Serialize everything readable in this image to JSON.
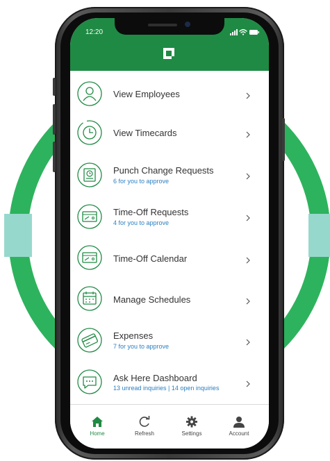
{
  "status_bar": {
    "time": "12:20"
  },
  "colors": {
    "brand_green": "#1f8a44",
    "ring_green": "#2db35d",
    "ring_teal": "#97d8cc",
    "link_blue": "#2a7fc1"
  },
  "menu": {
    "items": [
      {
        "title": "View Employees",
        "subtitle": "",
        "icon": "person-icon"
      },
      {
        "title": "View Timecards",
        "subtitle": "",
        "icon": "clock-icon"
      },
      {
        "title": "Punch Change Requests",
        "subtitle": "6 for you to approve",
        "icon": "punch-clock-icon"
      },
      {
        "title": "Time-Off Requests",
        "subtitle": "4 for you to approve",
        "icon": "ticket-icon"
      },
      {
        "title": "Time-Off Calendar",
        "subtitle": "",
        "icon": "ticket-icon"
      },
      {
        "title": "Manage Schedules",
        "subtitle": "",
        "icon": "calendar-icon"
      },
      {
        "title": "Expenses",
        "subtitle": "7 for you to approve",
        "icon": "credit-card-icon"
      },
      {
        "title": "Ask Here Dashboard",
        "subtitle": "13 unread inquiries | 14 open inquiries",
        "icon": "chat-icon"
      }
    ]
  },
  "tabbar": {
    "tabs": [
      {
        "label": "Home",
        "icon": "home-icon",
        "active": true
      },
      {
        "label": "Refresh",
        "icon": "refresh-icon",
        "active": false
      },
      {
        "label": "Settings",
        "icon": "gear-icon",
        "active": false
      },
      {
        "label": "Account",
        "icon": "account-icon",
        "active": false
      }
    ]
  }
}
